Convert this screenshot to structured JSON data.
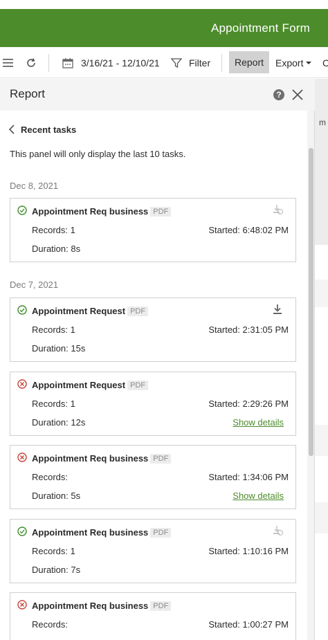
{
  "app": {
    "title": "Appointment Form",
    "accent": "#4c8c2b"
  },
  "toolbar": {
    "menu_icon": "hamburger-icon",
    "refresh_icon": "refresh-icon",
    "calendar_icon": "calendar-icon",
    "date_range": "3/16/21 - 12/10/21",
    "filter_label": "Filter",
    "report_label": "Report",
    "export_label": "Export",
    "more_label": "C"
  },
  "panel": {
    "title": "Report",
    "back_label": "Recent tasks",
    "notice": "This panel will only display the last 10 tasks.",
    "groups": [
      {
        "date": "Dec 8, 2021",
        "tasks": [
          {
            "status": "success",
            "name": "Appointment Req business",
            "badge": "PDF",
            "records": "Records: 1",
            "started": "Started: 6:48:02 PM",
            "duration": "Duration: 8s",
            "action": "download-disabled-icon"
          }
        ]
      },
      {
        "date": "Dec 7, 2021",
        "tasks": [
          {
            "status": "success",
            "name": "Appointment Request",
            "badge": "PDF",
            "records": "Records: 1",
            "started": "Started: 2:31:05 PM",
            "duration": "Duration: 15s",
            "action": "download-icon"
          },
          {
            "status": "error",
            "name": "Appointment Request",
            "badge": "PDF",
            "records": "Records: 1",
            "started": "Started: 2:29:26 PM",
            "duration": "Duration: 12s",
            "details": "Show details"
          },
          {
            "status": "error",
            "name": "Appointment Req business",
            "badge": "PDF",
            "records": "Records:",
            "started": "Started: 1:34:06 PM",
            "duration": "Duration: 5s",
            "details": "Show details"
          },
          {
            "status": "success",
            "name": "Appointment Req business",
            "badge": "PDF",
            "records": "Records: 1",
            "started": "Started: 1:10:16 PM",
            "duration": "Duration: 7s",
            "action": "download-disabled-icon"
          },
          {
            "status": "error",
            "name": "Appointment Req business",
            "badge": "PDF",
            "records": "Records:",
            "started": "Started: 1:00:27 PM",
            "duration": ""
          }
        ]
      }
    ]
  },
  "rightstrip": {
    "text": "m"
  },
  "colors": {
    "success": "#3f8f2e",
    "error": "#c8453b",
    "link": "#4c8c2b"
  }
}
